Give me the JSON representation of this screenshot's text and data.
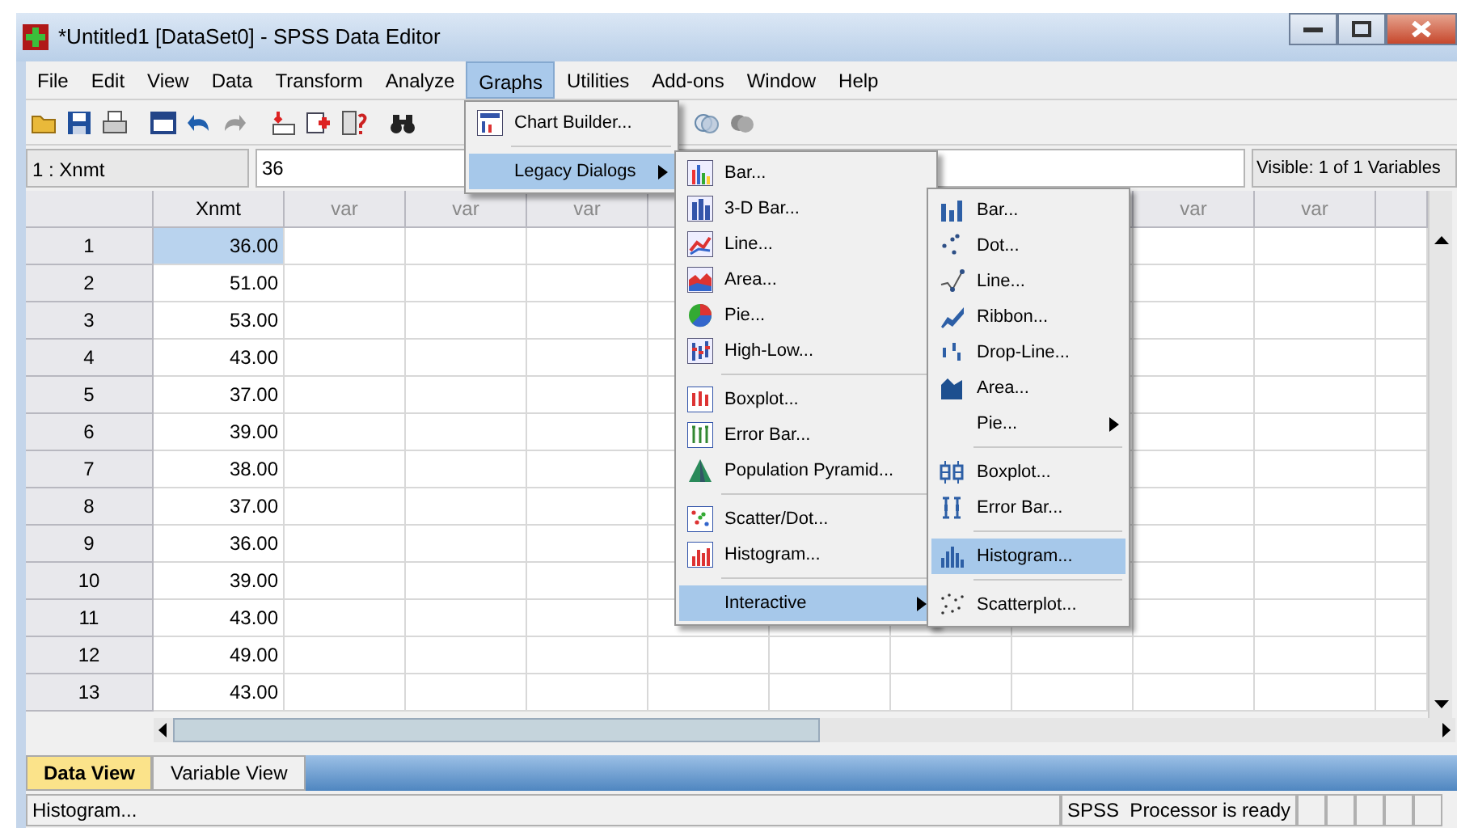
{
  "window": {
    "title": "*Untitled1 [DataSet0] - SPSS Data Editor"
  },
  "menu_bar": [
    {
      "label": "File",
      "selected": false
    },
    {
      "label": "Edit",
      "selected": false
    },
    {
      "label": "View",
      "selected": false
    },
    {
      "label": "Data",
      "selected": false
    },
    {
      "label": "Transform",
      "selected": false
    },
    {
      "label": "Analyze",
      "selected": false
    },
    {
      "label": "Graphs",
      "selected": true
    },
    {
      "label": "Utilities",
      "selected": false
    },
    {
      "label": "Add-ons",
      "selected": false
    },
    {
      "label": "Window",
      "selected": false
    },
    {
      "label": "Help",
      "selected": false
    }
  ],
  "cell_editor": {
    "cell_name": "1 : Xnmt",
    "value": "36",
    "visible_info": "Visible: 1 of 1 Variables"
  },
  "grid": {
    "columns_left": [
      "Xnmt",
      "var",
      "var",
      "var"
    ],
    "columns_right": [
      "var",
      "var"
    ],
    "rows": [
      {
        "number": "1",
        "value": "36.00",
        "selected": true
      },
      {
        "number": "2",
        "value": "51.00",
        "selected": false
      },
      {
        "number": "3",
        "value": "53.00",
        "selected": false
      },
      {
        "number": "4",
        "value": "43.00",
        "selected": false
      },
      {
        "number": "5",
        "value": "37.00",
        "selected": false
      },
      {
        "number": "6",
        "value": "39.00",
        "selected": false
      },
      {
        "number": "7",
        "value": "38.00",
        "selected": false
      },
      {
        "number": "8",
        "value": "37.00",
        "selected": false
      },
      {
        "number": "9",
        "value": "36.00",
        "selected": false
      },
      {
        "number": "10",
        "value": "39.00",
        "selected": false
      },
      {
        "number": "11",
        "value": "43.00",
        "selected": false
      },
      {
        "number": "12",
        "value": "49.00",
        "selected": false
      },
      {
        "number": "13",
        "value": "43.00",
        "selected": false
      }
    ]
  },
  "graphs_menu": [
    {
      "kind": "item",
      "label": "Chart Builder...",
      "selected": false,
      "submenu": false
    },
    {
      "kind": "separator"
    },
    {
      "kind": "item",
      "label": "Legacy Dialogs",
      "selected": true,
      "submenu": true
    }
  ],
  "legacy_menu": [
    {
      "kind": "item",
      "label": "Bar...",
      "selected": false,
      "submenu": false
    },
    {
      "kind": "item",
      "label": "3-D Bar...",
      "selected": false,
      "submenu": false
    },
    {
      "kind": "item",
      "label": "Line...",
      "selected": false,
      "submenu": false
    },
    {
      "kind": "item",
      "label": "Area...",
      "selected": false,
      "submenu": false
    },
    {
      "kind": "item",
      "label": "Pie...",
      "selected": false,
      "submenu": false
    },
    {
      "kind": "item",
      "label": "High-Low...",
      "selected": false,
      "submenu": false
    },
    {
      "kind": "separator"
    },
    {
      "kind": "item",
      "label": "Boxplot...",
      "selected": false,
      "submenu": false
    },
    {
      "kind": "item",
      "label": "Error Bar...",
      "selected": false,
      "submenu": false
    },
    {
      "kind": "item",
      "label": "Population Pyramid...",
      "selected": false,
      "submenu": false
    },
    {
      "kind": "separator"
    },
    {
      "kind": "item",
      "label": "Scatter/Dot...",
      "selected": false,
      "submenu": false
    },
    {
      "kind": "item",
      "label": "Histogram...",
      "selected": false,
      "submenu": false
    },
    {
      "kind": "separator"
    },
    {
      "kind": "item",
      "label": "Interactive",
      "selected": true,
      "submenu": true
    }
  ],
  "interactive_menu": [
    {
      "kind": "item",
      "label": "Bar...",
      "selected": false,
      "submenu": false
    },
    {
      "kind": "item",
      "label": "Dot...",
      "selected": false,
      "submenu": false
    },
    {
      "kind": "item",
      "label": "Line...",
      "selected": false,
      "submenu": false
    },
    {
      "kind": "item",
      "label": "Ribbon...",
      "selected": false,
      "submenu": false
    },
    {
      "kind": "item",
      "label": "Drop-Line...",
      "selected": false,
      "submenu": false
    },
    {
      "kind": "item",
      "label": "Area...",
      "selected": false,
      "submenu": false
    },
    {
      "kind": "item",
      "label": "Pie...",
      "selected": false,
      "submenu": true
    },
    {
      "kind": "separator"
    },
    {
      "kind": "item",
      "label": "Boxplot...",
      "selected": false,
      "submenu": false
    },
    {
      "kind": "item",
      "label": "Error Bar...",
      "selected": false,
      "submenu": false
    },
    {
      "kind": "separator"
    },
    {
      "kind": "item",
      "label": "Histogram...",
      "selected": true,
      "submenu": false
    },
    {
      "kind": "separator"
    },
    {
      "kind": "item",
      "label": "Scatterplot...",
      "selected": false,
      "submenu": false
    }
  ],
  "view_tabs": [
    {
      "label": "Data View",
      "selected": true
    },
    {
      "label": "Variable View",
      "selected": false
    }
  ],
  "status_bar": {
    "message": "Histogram...",
    "processor": "SPSS  Processor is ready"
  }
}
